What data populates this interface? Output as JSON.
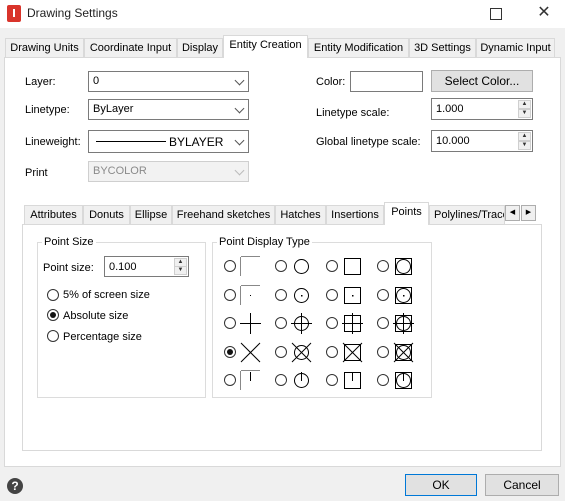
{
  "window": {
    "title": "Drawing Settings",
    "close_glyph": "✕"
  },
  "main_tabs": [
    {
      "label": "Drawing Units"
    },
    {
      "label": "Coordinate Input"
    },
    {
      "label": "Display"
    },
    {
      "label": "Entity Creation",
      "active": true
    },
    {
      "label": "Entity Modification"
    },
    {
      "label": "3D Settings"
    },
    {
      "label": "Dynamic Input"
    }
  ],
  "entity": {
    "layer_label": "Layer:",
    "layer_value": "0",
    "linetype_label": "Linetype:",
    "linetype_value": "ByLayer",
    "lineweight_label": "Lineweight:",
    "lineweight_value": "BYLAYER",
    "print_label": "Print",
    "print_value": "BYCOLOR",
    "color_label": "Color:",
    "select_color_label": "Select Color...",
    "linetype_scale_label": "Linetype scale:",
    "linetype_scale_value": "1.000",
    "global_linetype_scale_label": "Global linetype scale:",
    "global_linetype_scale_value": "10.000"
  },
  "sub_tabs": [
    {
      "label": "Attributes"
    },
    {
      "label": "Donuts"
    },
    {
      "label": "Ellipse"
    },
    {
      "label": "Freehand sketches"
    },
    {
      "label": "Hatches"
    },
    {
      "label": "Insertions"
    },
    {
      "label": "Points",
      "active": true
    },
    {
      "label": "Polylines/Trace"
    }
  ],
  "point_size": {
    "group_title": "Point Size",
    "size_label": "Point size:",
    "size_value": "0.100",
    "options": [
      {
        "label": "5% of screen size",
        "checked": false
      },
      {
        "label": "Absolute size",
        "checked": true
      },
      {
        "label": "Percentage size",
        "checked": false
      }
    ]
  },
  "point_display": {
    "group_title": "Point Display Type",
    "selected": "row4-col1",
    "types": [
      [
        "dot-corner",
        "circle",
        "square",
        "square-circle"
      ],
      [
        "dot",
        "circle-dot",
        "square-dot",
        "square-circle-dot"
      ],
      [
        "plus",
        "circle-plus",
        "square-plus",
        "square-circle-plus"
      ],
      [
        "x",
        "circle-x",
        "square-x",
        "square-circle-x"
      ],
      [
        "tick",
        "circle-tick",
        "square-tick",
        "square-circle-tick"
      ]
    ]
  },
  "footer": {
    "help_icon": "?",
    "ok_label": "OK",
    "cancel_label": "Cancel"
  }
}
